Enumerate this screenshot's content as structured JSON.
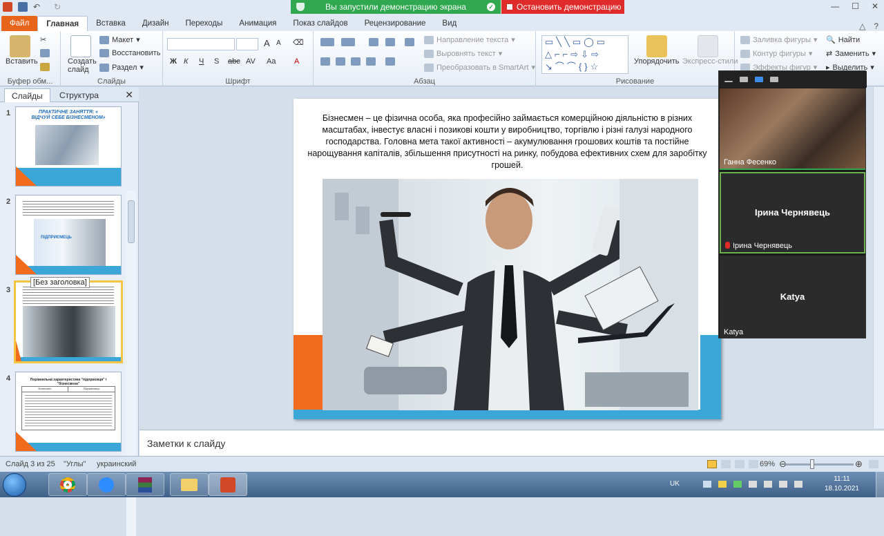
{
  "share_bar": {
    "status": "Вы запустили демонстрацию экрана",
    "stop": "Остановить демонстрацию"
  },
  "tabs": [
    "Файл",
    "Главная",
    "Вставка",
    "Дизайн",
    "Переходы",
    "Анимация",
    "Показ слайдов",
    "Рецензирование",
    "Вид"
  ],
  "ribbon": {
    "paste": "Вставить",
    "clipboard_label": "Буфер обм...",
    "new_slide": "Создать слайд",
    "layout": "Макет",
    "reset": "Восстановить",
    "section": "Раздел",
    "slides_label": "Слайды",
    "font_label": "Шрифт",
    "bold": "Ж",
    "italic": "К",
    "underline": "Ч",
    "strike": "S",
    "abc": "abc",
    "spacing": "AV",
    "case": "Aa",
    "grow": "A",
    "shrink": "A",
    "text_direction": "Направление текста",
    "align_text": "Выровнять текст",
    "smartart": "Преобразовать в SmartArt",
    "paragraph_label": "Абзац",
    "arrange": "Упорядочить",
    "quick_styles": "Экспресс-стили",
    "shape_fill": "Заливка фигуры",
    "shape_outline": "Контур фигуры",
    "shape_effects": "Эффекты фигур",
    "drawing_label": "Рисование",
    "find": "Найти",
    "replace": "Заменить",
    "select": "Выделить"
  },
  "left_pane": {
    "tab_slides": "Слайды",
    "tab_outline": "Структура",
    "tooltip": "[Без заголовка]",
    "thumbs": [
      {
        "num": "1",
        "title": "ПРАКТИЧНЕ ЗАНЯТТЯ: « ВІДЧУЙ СЕБЕ БІЗНЕСМЕНОМ»"
      },
      {
        "num": "2",
        "title": "ПІДПРИЄМЕЦЬ"
      },
      {
        "num": "3",
        "title": ""
      },
      {
        "num": "4",
        "title": "Порівняльна характеристика \"підприємця\" і \"бізнесмена\"",
        "col1": "Бізнесмен",
        "col2": "Підприємець"
      }
    ]
  },
  "slide": {
    "text": "Бізнесмен – це фізична особа, яка професійно займається комерційною діяльністю в різних масштабах, інвестує власні і позикові кошти у виробництво, торгівлю і різні галузі народного господарства. Головна мета такої активності – акумулювання грошових коштів та постійне нарощування капіталів, збільшення присутності на ринку, побудова ефективних схем для заробітку грошей."
  },
  "notes": "Заметки к слайду",
  "status": {
    "slide": "Слайд 3 из 25",
    "theme": "\"Углы\"",
    "lang": "украинский",
    "zoom": "69%"
  },
  "zoom": {
    "participants": [
      {
        "name": "Ганна Фесенко"
      },
      {
        "name": "Ірина Чернявець",
        "center": "Ірина Чернявець"
      },
      {
        "name": "Katya",
        "center": "Katya"
      }
    ]
  },
  "tray": {
    "lang": "UK",
    "time": "11:11",
    "date": "18.10.2021"
  },
  "colors": {
    "share_green": "#2fa84f",
    "share_red": "#e02b2b",
    "file_tab": "#e8641b",
    "slide_orange": "#f26a1b",
    "slide_blue": "#3aa7d8"
  }
}
